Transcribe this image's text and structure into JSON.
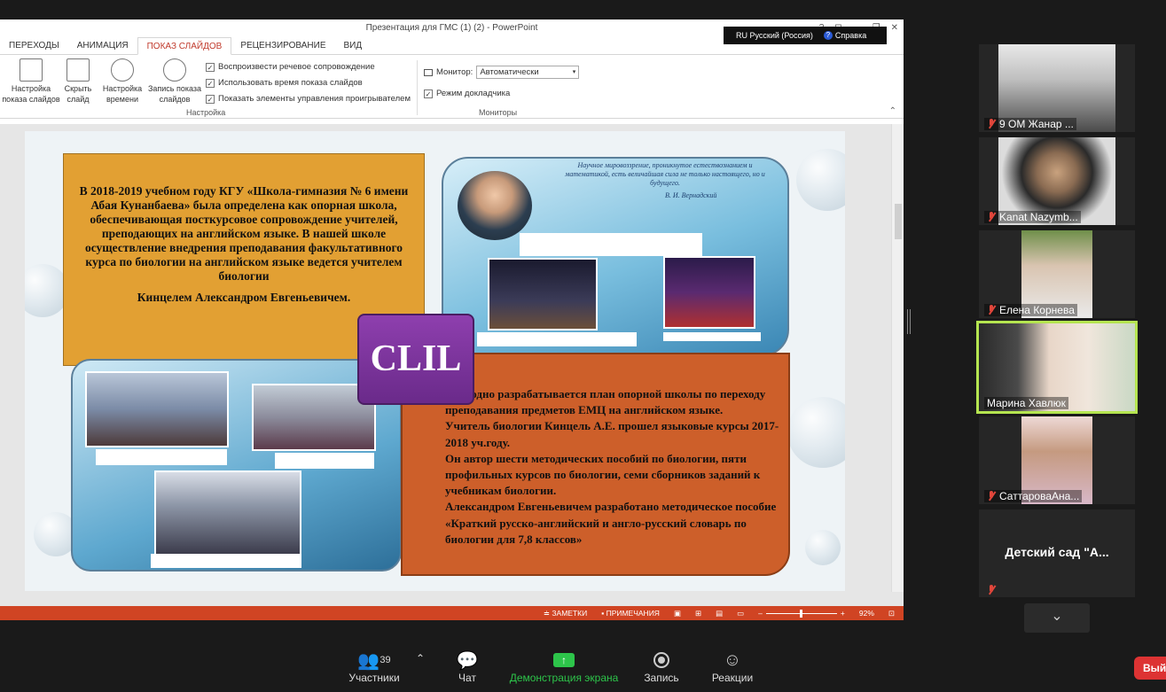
{
  "ppt": {
    "title": "Презентация для ГМС (1) (2) - PowerPoint",
    "window_controls": [
      "?",
      "⊡",
      "—",
      "❐",
      "✕"
    ],
    "tabs": [
      "ПЕРЕХОДЫ",
      "АНИМАЦИЯ",
      "ПОКАЗ СЛАЙДОВ",
      "РЕЦЕНЗИРОВАНИЕ",
      "ВИД"
    ],
    "ribbon": {
      "setup_show": "Настройка показа слайдов",
      "hide_slide": "Скрыть слайд",
      "rehearse": "Настройка времени",
      "record": "Запись показа слайдов",
      "group_setup": "Настройка",
      "chk_narration": "Воспроизвести речевое сопровождение",
      "chk_timings": "Использовать время показа слайдов",
      "chk_controls": "Показать элементы управления проигрывателем",
      "monitor_label": "Монитор:",
      "monitor_value": "Автоматически",
      "presenter_view": "Режим докладчика",
      "group_monitors": "Мониторы"
    },
    "language_bar": {
      "lang": "RU Русский (Россия)",
      "help": "Справка"
    },
    "status": {
      "notes": "ЗАМЕТКИ",
      "comments": "ПРИМЕЧАНИЯ",
      "zoom": "92%"
    }
  },
  "slide": {
    "left_text": "В 2018-2019 учебном году КГУ «Школа-гимназия № 6 имени Абая Кунанбаева» была определена как опорная школа, обеспечивающая посткурсовое сопровождение учителей, преподающих на английском языке. В нашей школе осуществление внедрения преподавания факультативного курса по биологии на английском языке ведется учителем биологии",
    "left_name": "Кинцелем Александром Евгеньевичем.",
    "clil": "CLIL",
    "right_text": " Ежегодно разрабатывается план опорной школы по переходу преподавания предметов ЕМЦ на английском языке.\nУчитель биологии Кинцель А.Е. прошел языковые курсы 2017-2018 уч.году.\nОн  автор шести методических пособий по биологии, пяти профильных курсов по биологии, семи сборников заданий к учебникам биологии.\nАлександром Евгеньевичем разработано методическое пособие «Краткий русско-английский и англо-русский словарь по биологии для 7,8 классов»",
    "quote": "Научное мировоззрение, проникнутое естествознанием и математикой, есть величайшая сила не только настоящего, но и будущего.",
    "quote_author": "В. И. Вернадский"
  },
  "participants": [
    {
      "name": "9 ОМ Жанар ...",
      "muted": true
    },
    {
      "name": "Kanat Nazymb...",
      "muted": true
    },
    {
      "name": "Елена Корнева",
      "muted": true
    },
    {
      "name": "Марина Хавлюк",
      "muted": false,
      "active_speaker": true
    },
    {
      "name": "СаттароваАна...",
      "muted": true
    },
    {
      "name": "Детский сад \"А...",
      "muted": true,
      "video": false
    }
  ],
  "toolbar": {
    "participants_label": "Участники",
    "participants_count": "39",
    "chat": "Чат",
    "share": "Демонстрация экрана",
    "record": "Запись",
    "reactions": "Реакции",
    "exit": "Вый"
  },
  "colors": {
    "accent_red": "#c0392b",
    "status_bar": "#d04423",
    "share_green": "#2dc44a",
    "active_speaker": "#b5e550"
  }
}
